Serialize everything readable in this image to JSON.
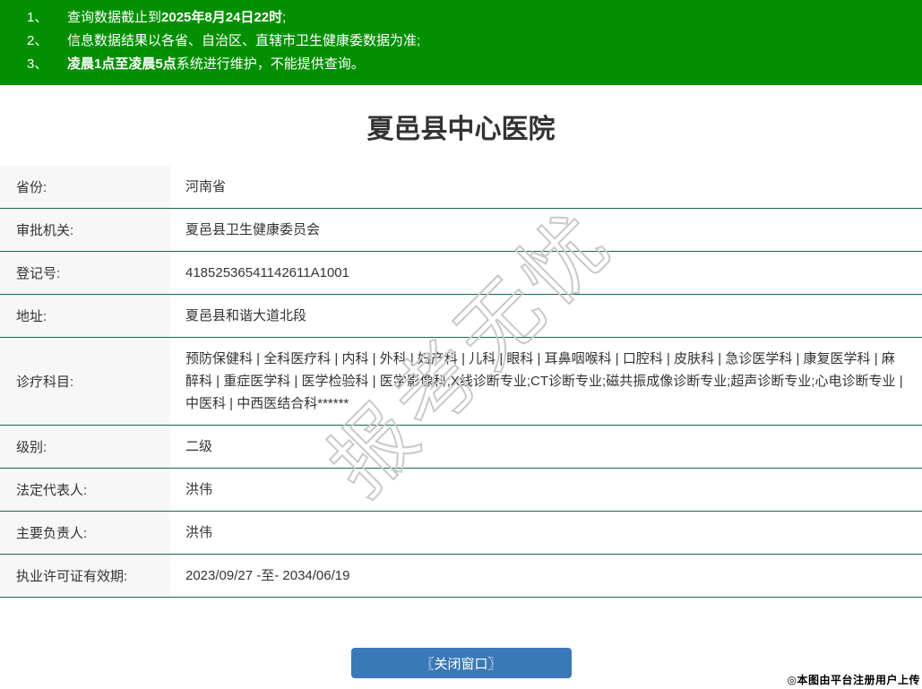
{
  "colors": {
    "banner_bg": "#029002",
    "banner_text": "#ffffff",
    "row_border_green": "#186a46",
    "label_bg": "#f7f7f7",
    "body_text": "#333333",
    "button_bg": "#3a79b7",
    "button_text": "#ffffff",
    "watermark_stroke": "#c9c9c9"
  },
  "banner": {
    "notices": [
      {
        "num": "1、",
        "parts": [
          {
            "text": "查询数据截止到",
            "bold": false
          },
          {
            "text": "2025年8月24日22时",
            "bold": true
          },
          {
            "text": ";",
            "bold": false
          }
        ]
      },
      {
        "num": "2、",
        "parts": [
          {
            "text": "信息数据结果以各省、自治区、直辖市卫生健康委数据为准;",
            "bold": false
          }
        ]
      },
      {
        "num": "3、",
        "parts": [
          {
            "text": "凌晨1点至凌晨5点",
            "bold": true
          },
          {
            "text": "系统进行维护，不能提供查询。",
            "bold": false
          }
        ]
      }
    ]
  },
  "page": {
    "title": "夏邑县中心医院"
  },
  "table": {
    "rows": [
      {
        "label": "省份:",
        "value": "河南省"
      },
      {
        "label": "审批机关:",
        "value": "夏邑县卫生健康委员会"
      },
      {
        "label": "登记号:",
        "value": "41852536541142611A1001"
      },
      {
        "label": "地址:",
        "value": "夏邑县和谐大道北段"
      },
      {
        "label": "诊疗科目:",
        "value": "预防保健科 | 全科医疗科 | 内科 | 外科 | 妇产科 | 儿科 | 眼科 | 耳鼻咽喉科 | 口腔科 | 皮肤科 | 急诊医学科 | 康复医学科 | 麻醉科 | 重症医学科 | 医学检验科 | 医学影像科;X线诊断专业;CT诊断专业;磁共振成像诊断专业;超声诊断专业;心电诊断专业 | 中医科 | 中西医结合科******"
      },
      {
        "label": "级别:",
        "value": "二级"
      },
      {
        "label": "法定代表人:",
        "value": "洪伟"
      },
      {
        "label": "主要负责人:",
        "value": "洪伟"
      },
      {
        "label": "执业许可证有效期:",
        "value": "2023/09/27 -至- 2034/06/19"
      }
    ]
  },
  "footer": {
    "close_button_label": "〖关闭窗口〗",
    "upload_note": "◎本图由平台注册用户上传"
  },
  "watermark": {
    "text": "报考无忧"
  }
}
